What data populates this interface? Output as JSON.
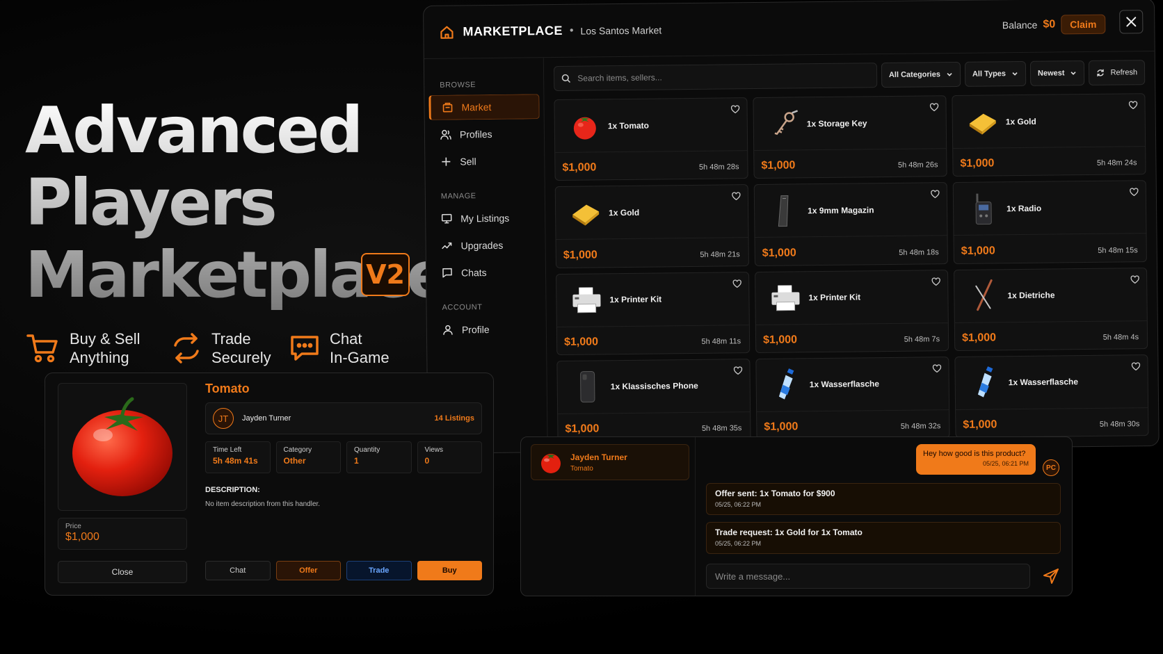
{
  "hero": {
    "line1": "Advanced",
    "line2": "Players",
    "line3": "Marketplace",
    "badge": "V2",
    "features": [
      {
        "icon": "cart-icon",
        "line1": "Buy & Sell",
        "line2": "Anything"
      },
      {
        "icon": "exchange-icon",
        "line1": "Trade",
        "line2": "Securely"
      },
      {
        "icon": "chat-bubble-icon",
        "line1": "Chat",
        "line2": "In-Game"
      }
    ]
  },
  "window": {
    "title": "MARKETPLACE",
    "separator": "•",
    "subtitle": "Los Santos Market",
    "balance_label": "Balance",
    "balance_value": "$0",
    "claim_label": "Claim"
  },
  "sidebar": {
    "browse_header": "BROWSE",
    "browse": [
      {
        "label": "Market",
        "icon": "store-icon",
        "active": true
      },
      {
        "label": "Profiles",
        "icon": "users-icon"
      },
      {
        "label": "Sell",
        "icon": "plus-icon"
      }
    ],
    "manage_header": "MANAGE",
    "manage": [
      {
        "label": "My Listings",
        "icon": "monitor-icon"
      },
      {
        "label": "Upgrades",
        "icon": "trend-icon"
      },
      {
        "label": "Chats",
        "icon": "message-icon"
      }
    ],
    "account_header": "ACCOUNT",
    "account": [
      {
        "label": "Profile",
        "icon": "user-icon"
      }
    ]
  },
  "filters": {
    "search_placeholder": "Search items, sellers...",
    "category": "All Categories",
    "type": "All Types",
    "sort": "Newest",
    "refresh": "Refresh"
  },
  "listings": [
    {
      "name": "1x Tomato",
      "price": "$1,000",
      "time": "5h 48m 28s",
      "icon": "tomato-icon"
    },
    {
      "name": "1x Storage Key",
      "price": "$1,000",
      "time": "5h 48m 26s",
      "icon": "key-icon"
    },
    {
      "name": "1x Gold",
      "price": "$1,000",
      "time": "5h 48m 24s",
      "icon": "gold-bar-icon"
    },
    {
      "name": "1x Gold",
      "price": "$1,000",
      "time": "5h 48m 21s",
      "icon": "gold-bar-icon"
    },
    {
      "name": "1x 9mm Magazin",
      "price": "$1,000",
      "time": "5h 48m 18s",
      "icon": "magazine-icon"
    },
    {
      "name": "1x Radio",
      "price": "$1,000",
      "time": "5h 48m 15s",
      "icon": "radio-icon"
    },
    {
      "name": "1x Printer Kit",
      "price": "$1,000",
      "time": "5h 48m 11s",
      "icon": "printer-icon"
    },
    {
      "name": "1x Printer Kit",
      "price": "$1,000",
      "time": "5h 48m 7s",
      "icon": "printer-icon"
    },
    {
      "name": "1x Dietriche",
      "price": "$1,000",
      "time": "5h 48m 4s",
      "icon": "lockpick-icon"
    },
    {
      "name": "1x Klassisches Phone",
      "price": "$1,000",
      "time": "5h 48m 35s",
      "icon": "phone-icon"
    },
    {
      "name": "1x Wasserflasche",
      "price": "$1,000",
      "time": "5h 48m 32s",
      "icon": "water-bottle-icon"
    },
    {
      "name": "1x Wasserflasche",
      "price": "$1,000",
      "time": "5h 48m 30s",
      "icon": "water-bottle-icon"
    }
  ],
  "detail": {
    "title": "Tomato",
    "seller_initials": "JT",
    "seller_name": "Jayden Turner",
    "seller_listings": "14 Listings",
    "price_label": "Price",
    "price_value": "$1,000",
    "close_label": "Close",
    "stats": [
      {
        "label": "Time Left",
        "value": "5h 48m 41s"
      },
      {
        "label": "Category",
        "value": "Other"
      },
      {
        "label": "Quantity",
        "value": "1"
      },
      {
        "label": "Views",
        "value": "0"
      }
    ],
    "description_header": "DESCRIPTION:",
    "description": "No item description from this handler.",
    "buttons": {
      "chat": "Chat",
      "offer": "Offer",
      "trade": "Trade",
      "buy": "Buy"
    }
  },
  "chat": {
    "conversation": {
      "name": "Jayden Turner",
      "item": "Tomato"
    },
    "outgoing": {
      "text": "Hey how good is this product?",
      "date": "05/25, 06:21 PM",
      "avatar": "PC"
    },
    "system": [
      {
        "text": "Offer sent: 1x Tomato for $900",
        "date": "05/25, 06:22 PM"
      },
      {
        "text": "Trade request: 1x Gold for 1x Tomato",
        "date": "05/25, 06:22 PM"
      }
    ],
    "input_placeholder": "Write a message..."
  },
  "colors": {
    "accent": "#f07a1a",
    "background": "#0b0b0b",
    "trade_blue": "#6aa6ff"
  }
}
